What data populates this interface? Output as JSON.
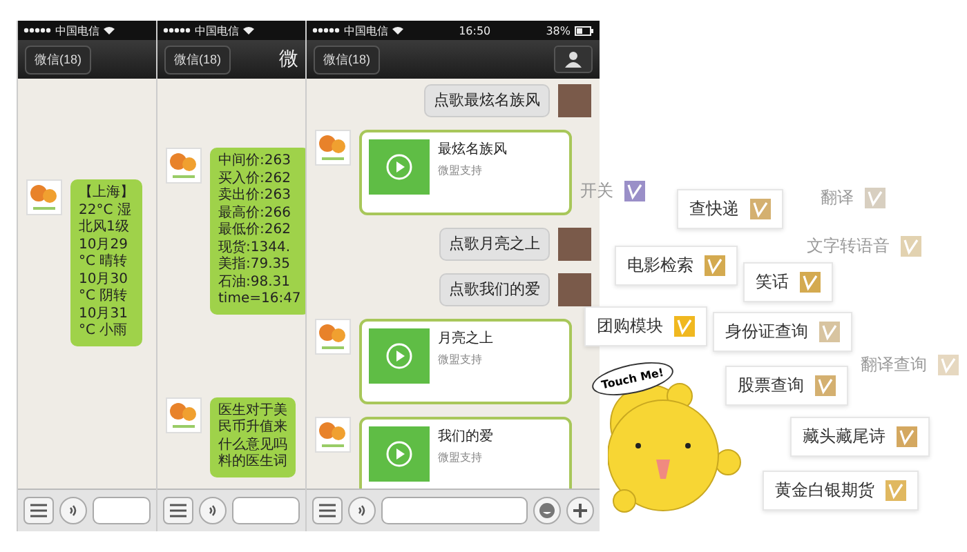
{
  "phones": [
    {
      "status": {
        "carrier": "中国电信"
      },
      "nav": {
        "back": "微信(18)"
      },
      "messages": [
        {
          "kind": "text",
          "outgoing": false,
          "lines": [
            "【上海】",
            "22°C 湿",
            "北风1级",
            "10月29",
            "°C 晴转",
            "10月30",
            "°C 阴转",
            "10月31",
            "°C 小雨"
          ]
        }
      ]
    },
    {
      "status": {
        "carrier": "中国电信"
      },
      "nav": {
        "back": "微信(18)",
        "title": "微"
      },
      "messages": [
        {
          "kind": "text",
          "outgoing": false,
          "lines": [
            "中间价:263",
            "买入价:262",
            "卖出价:263",
            "最高价:266",
            "最低价:262",
            "现货:1344.",
            "美指:79.35",
            "石油:98.31",
            "time=16:47"
          ]
        },
        {
          "kind": "text",
          "outgoing": false,
          "lines": [
            "医生对于美",
            "民币升值来",
            "什么意见吗",
            "料的医生词"
          ]
        }
      ]
    },
    {
      "status": {
        "carrier": "中国电信",
        "time": "16:50",
        "battery": "38%"
      },
      "nav": {
        "back": "微信(18)"
      },
      "messages": [
        {
          "kind": "text",
          "outgoing": true,
          "lines": [
            "点歌最炫名族风"
          ]
        },
        {
          "kind": "music",
          "outgoing": false,
          "title": "最炫名族风",
          "subtitle": "微盟支持"
        },
        {
          "kind": "text",
          "outgoing": true,
          "lines": [
            "点歌月亮之上"
          ]
        },
        {
          "kind": "text",
          "outgoing": true,
          "lines": [
            "点歌我们的爱"
          ]
        },
        {
          "kind": "music",
          "outgoing": false,
          "title": "月亮之上",
          "subtitle": "微盟支持"
        },
        {
          "kind": "music",
          "outgoing": false,
          "title": "我们的爱",
          "subtitle": "微盟支持"
        }
      ]
    }
  ],
  "tags": [
    {
      "label": "开关",
      "faded": true,
      "color": "#9a8fc8"
    },
    {
      "label": "查快递",
      "faded": false,
      "color": "#d4b070"
    },
    {
      "label": "翻译",
      "faded": true,
      "color": "#d8cfc0"
    },
    {
      "label": "电影检索",
      "faded": false,
      "color": "#d4aa50"
    },
    {
      "label": "文字转语音",
      "faded": true,
      "color": "#e2d2b0"
    },
    {
      "label": "笑话",
      "faded": false,
      "color": "#d4aa50"
    },
    {
      "label": "团购模块",
      "faded": false,
      "color": "#f0b820"
    },
    {
      "label": "身份证查询",
      "faded": false,
      "color": "#d8c4a0"
    },
    {
      "label": "翻译查询",
      "faded": true,
      "color": "#e6d8c0"
    },
    {
      "label": "股票查询",
      "faded": false,
      "color": "#d4b070"
    },
    {
      "label": "藏头藏尾诗",
      "faded": false,
      "color": "#d4a860"
    },
    {
      "label": "黄金白银期货",
      "faded": false,
      "color": "#e0b860"
    }
  ],
  "mascot": {
    "speech": "Touch Me!"
  }
}
